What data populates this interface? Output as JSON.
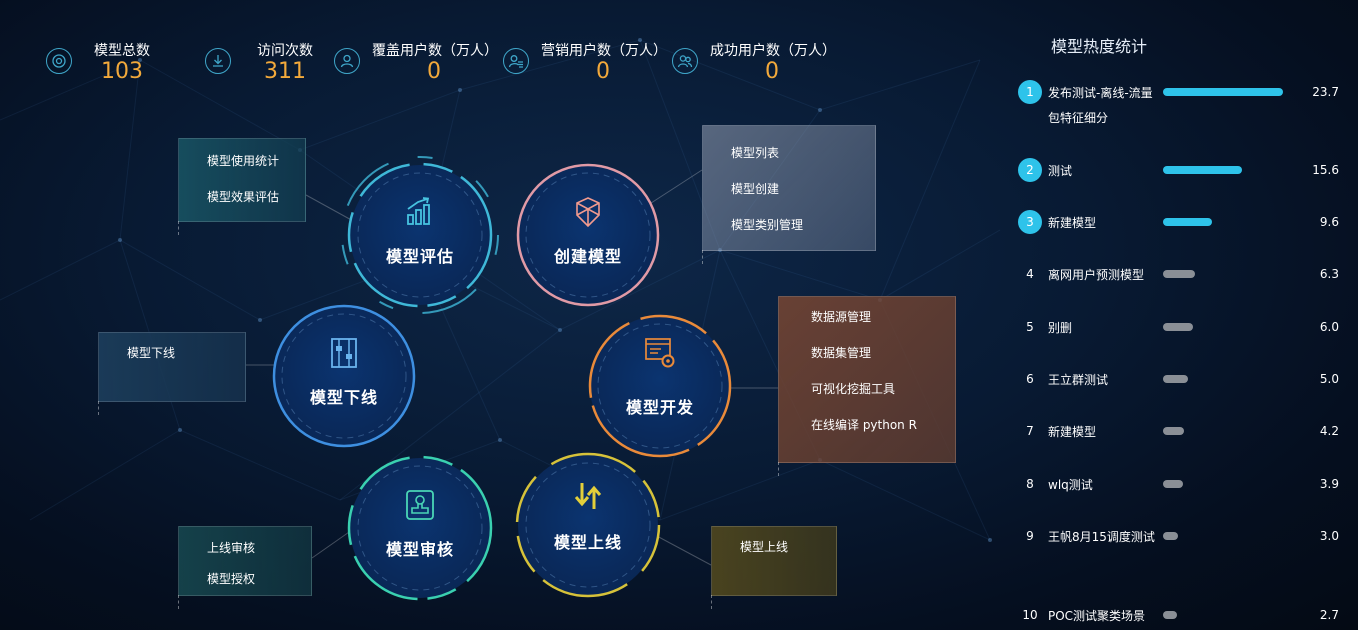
{
  "stats": [
    {
      "label": "模型总数",
      "value": "103",
      "icon": "target-icon"
    },
    {
      "label": "访问次数",
      "value": "311",
      "icon": "download-icon"
    },
    {
      "label": "覆盖用户数（万人）",
      "value": "0",
      "icon": "user-icon"
    },
    {
      "label": "营销用户数（万人）",
      "value": "0",
      "icon": "user-list-icon"
    },
    {
      "label": "成功用户数（万人）",
      "value": "0",
      "icon": "users-icon"
    }
  ],
  "flow": {
    "evaluate": {
      "label": "模型评估",
      "icon": "chart-up-icon",
      "color": "#3fb8d8"
    },
    "create": {
      "label": "创建模型",
      "icon": "cube-icon",
      "color": "#e09aa6"
    },
    "offline": {
      "label": "模型下线",
      "icon": "abacus-icon",
      "color": "#3e8fe0"
    },
    "develop": {
      "label": "模型开发",
      "icon": "code-gear-icon",
      "color": "#e98a3a"
    },
    "review": {
      "label": "模型审核",
      "icon": "stamp-icon",
      "color": "#3ad0b0"
    },
    "online": {
      "label": "模型上线",
      "icon": "sort-arrows-icon",
      "color": "#d6c23a"
    }
  },
  "boxes": {
    "evaluate": [
      "模型使用统计",
      "模型效果评估"
    ],
    "create": [
      "模型列表",
      "模型创建",
      "模型类别管理"
    ],
    "offline": [
      "模型下线"
    ],
    "develop": [
      "数据源管理",
      "数据集管理",
      "可视化挖掘工具",
      "在线编译  python  R"
    ],
    "review": [
      "上线审核",
      "模型授权"
    ],
    "online": [
      "模型上线"
    ]
  },
  "ranking": {
    "title": "模型热度统计",
    "colors": {
      "top": "#2ec3ea",
      "other": "#8a8f96"
    },
    "items": [
      {
        "rank": "1",
        "name": "发布测试-离线-流量包特征细分",
        "value": 23.7
      },
      {
        "rank": "2",
        "name": "测试",
        "value": 15.6
      },
      {
        "rank": "3",
        "name": "新建模型",
        "value": 9.6
      },
      {
        "rank": "4",
        "name": "离网用户预测模型",
        "value": 6.3
      },
      {
        "rank": "5",
        "name": "别删",
        "value": 6.0
      },
      {
        "rank": "6",
        "name": "王立群测试",
        "value": 5.0
      },
      {
        "rank": "7",
        "name": "新建模型",
        "value": 4.2
      },
      {
        "rank": "8",
        "name": "wlq测试",
        "value": 3.9
      },
      {
        "rank": "9",
        "name": "王帆8月15调度测试",
        "value": 3.0
      },
      {
        "rank": "10",
        "name": "POC测试聚类场景",
        "value": 2.7
      }
    ]
  }
}
